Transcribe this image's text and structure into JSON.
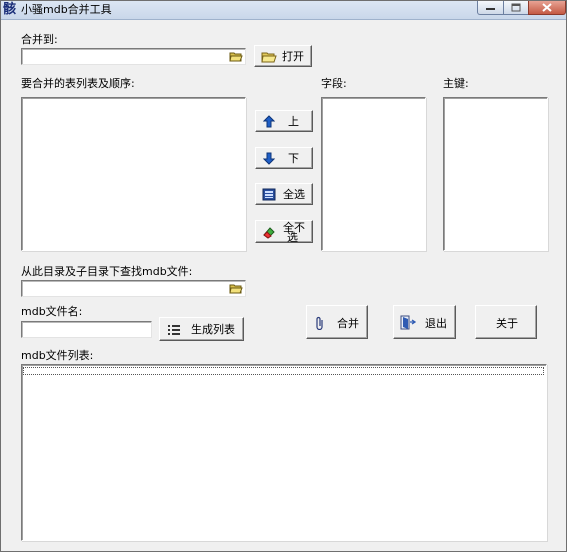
{
  "window": {
    "title": "小骚mdb合并工具",
    "icon_glyph": "骸"
  },
  "merge_to": {
    "label": "合并到:",
    "value": ""
  },
  "open_button": {
    "label": "打开"
  },
  "tables_section": {
    "label": "要合并的表列表及顺序:",
    "items": []
  },
  "fields_section": {
    "label": "字段:",
    "items": []
  },
  "keys_section": {
    "label": "主键:",
    "items": []
  },
  "buttons": {
    "up": "上",
    "down": "下",
    "select_all": "全选",
    "select_none_line1": "全不",
    "select_none_line2": "选",
    "merge": "合并",
    "exit": "退出",
    "about": "关于",
    "generate_list": "生成列表"
  },
  "search_dir": {
    "label": "从此目录及子目录下查找mdb文件:",
    "value": ""
  },
  "mdb_filename": {
    "label": "mdb文件名:",
    "value": ""
  },
  "mdb_list": {
    "label": "mdb文件列表:",
    "items": []
  },
  "colors": {
    "titlebar_top": "#dce6f3",
    "titlebar_bottom": "#c9d7ea",
    "window_bg": "#f0f0f0",
    "close_red": "#c45a44",
    "arrow_blue": "#1f5fc7"
  }
}
